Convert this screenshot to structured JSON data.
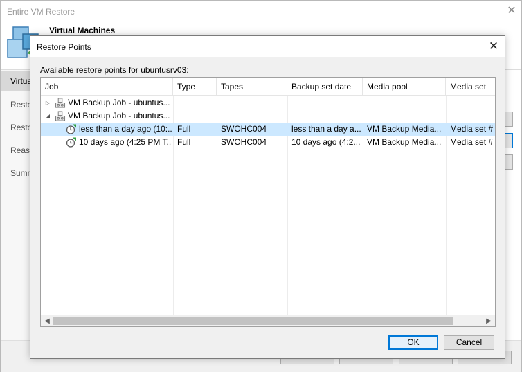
{
  "outer_window": {
    "title": "Entire VM Restore",
    "header_title": "Virtual Machines",
    "steps": [
      "Virtual Machines",
      "Restore Mode",
      "Restore Point",
      "Reason",
      "Summary"
    ],
    "active_step": 0
  },
  "dialog": {
    "title": "Restore Points",
    "caption": "Available restore points for ubuntusrv03:",
    "columns": [
      "Job",
      "Type",
      "Tapes",
      "Backup set date",
      "Media pool",
      "Media set"
    ],
    "rows": [
      {
        "expander": "collapsed",
        "kind": "job",
        "job": "VM Backup Job - ubuntus...",
        "type": "",
        "tapes": "",
        "date": "",
        "pool": "",
        "mediaset": ""
      },
      {
        "expander": "expanded",
        "kind": "job",
        "job": "VM Backup Job - ubuntus...",
        "type": "",
        "tapes": "",
        "date": "",
        "pool": "",
        "mediaset": ""
      },
      {
        "expander": "none",
        "kind": "point",
        "job": "less than a day ago (10:...",
        "type": "Full",
        "tapes": "SWOHC004",
        "date": "less than a day a...",
        "pool": "VM Backup Media...",
        "mediaset": "Media set #",
        "selected": true
      },
      {
        "expander": "none",
        "kind": "point",
        "job": "10 days ago (4:25 PM T...",
        "type": "Full",
        "tapes": "SWOHC004",
        "date": "10 days ago (4:2...",
        "pool": "VM Backup Media...",
        "mediaset": "Media set #"
      }
    ],
    "ok_label": "OK",
    "cancel_label": "Cancel"
  },
  "colors": {
    "selection": "#cce8ff",
    "accent": "#0078d7",
    "restore_point_green": "#2e9c3f"
  },
  "icons": {
    "job": "tape-backup-job-icon",
    "point": "restore-point-clock-icon"
  }
}
